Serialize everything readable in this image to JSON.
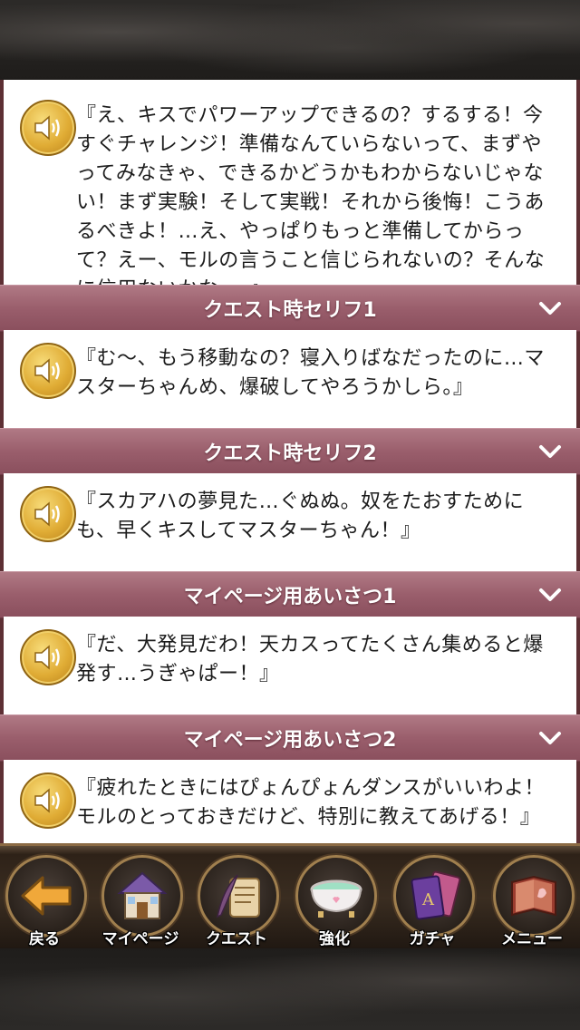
{
  "dialogue_lines": {
    "intro": "『え、キスでパワーアップできるの？するする！今すぐチャレンジ！準備なんていらないって、まずやってみなきゃ、できるかどうかもわからないじゃない！まず実験！そして実戦！それから後悔！こうあるべきよ！…え、やっぱりもっと準備してからって？えー、モルの言うこと信じられないの？そんなに信用ないかなー。』",
    "sections": [
      {
        "title": "クエスト時セリフ1",
        "line": "『む～、もう移動なの？寝入りばなだったのに…マスターちゃんめ、爆破してやろうかしら。』"
      },
      {
        "title": "クエスト時セリフ2",
        "line": "『スカアハの夢見た…ぐぬぬ。奴をたおすためにも、早くキスしてマスターちゃん！』"
      },
      {
        "title": "マイページ用あいさつ1",
        "line": "『だ、大発見だわ！天カスってたくさん集めると爆発す…うぎゃぱー！』"
      },
      {
        "title": "マイページ用あいさつ2",
        "line": "『疲れたときにはぴょんぴょんダンスがいいわよ！モルのとっておきだけど、特別に教えてあげる！』"
      }
    ]
  },
  "nav": {
    "back": "戻る",
    "mypage": "マイページ",
    "quest": "クエスト",
    "enhance": "強化",
    "gacha": "ガチャ",
    "menu": "メニュー"
  },
  "colors": {
    "header_bar": "#9a5e6c",
    "speaker_gold": "#e0ac35",
    "background": "#1b1917"
  },
  "icons": [
    "speaker-icon",
    "chevron-down-icon",
    "back-arrow-icon",
    "house-icon",
    "scroll-quill-icon",
    "bathtub-icon",
    "card-deck-icon",
    "menu-book-icon"
  ]
}
